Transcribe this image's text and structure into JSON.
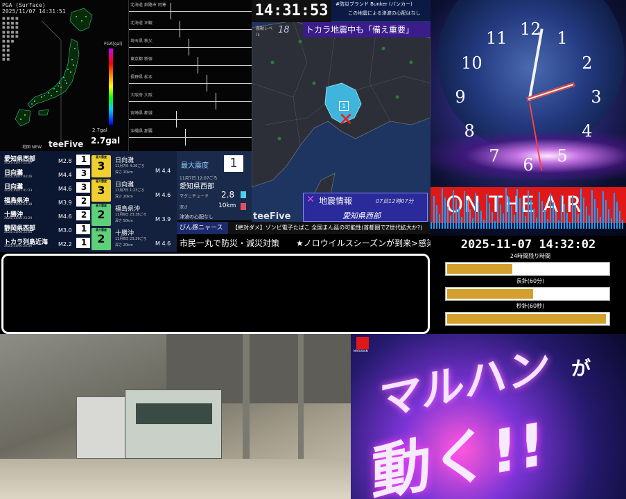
{
  "pga": {
    "title": "PGA (Surface)",
    "timestamp": "2025/11/07 14:31:51",
    "scale_label": "PGA[gal]",
    "gal_small": "2.7gal",
    "gal_big": "2.7gal",
    "logo": "teeFive",
    "new_label": "地図 NEW"
  },
  "waveforms": {
    "stations": [
      "北海道 釧路市 阿寒",
      "北海道 正観",
      "埼玉県 秩父",
      "東京都 新宿",
      "長野県 松本",
      "大阪府 大阪",
      "宮崎県 都城",
      "沖縄県 那覇"
    ]
  },
  "quake_list": [
    {
      "name": "愛知県西部",
      "date": "2025/11/07 12:07",
      "mag": "M2.8",
      "int": "1"
    },
    {
      "name": "日向灘",
      "date": "2025/11/07 04:26",
      "mag": "M4.4",
      "int": "3"
    },
    {
      "name": "日向灘",
      "date": "2025/11/07 01:23",
      "mag": "M4.6",
      "int": "3"
    },
    {
      "name": "福島県沖",
      "date": "2025/11/06 23:38",
      "mag": "M3.9",
      "int": "2"
    },
    {
      "name": "十勝沖",
      "date": "2025/11/06 23:29",
      "mag": "M4.6",
      "int": "2"
    },
    {
      "name": "静岡県西部",
      "date": "2025/11/06 22:05",
      "mag": "M3.0",
      "int": "1"
    },
    {
      "name": "トカラ列島近海",
      "date": "2025/11/06 20:16",
      "mag": "M2.2",
      "int": "1"
    }
  ],
  "detail_list": [
    {
      "label": "最大震度",
      "int": "3",
      "name": "日向灘",
      "sub": "11月7日 4:26ごろ",
      "depth": "深さ 20km",
      "mag": "M 4.4",
      "color": "#f0d030"
    },
    {
      "label": "最大震度",
      "int": "3",
      "name": "日向灘",
      "sub": "11月7日 1:23ごろ",
      "depth": "深さ 20km",
      "mag": "M 4.6",
      "color": "#f0d030"
    },
    {
      "label": "最大震度",
      "int": "2",
      "name": "福島県沖",
      "sub": "11月6日 23:38ごろ",
      "depth": "深さ 50km",
      "mag": "M 3.9",
      "color": "#5fd07a"
    },
    {
      "label": "最大震度",
      "int": "2",
      "name": "十勝沖",
      "sub": "11月6日 23:29ごろ",
      "depth": "深さ 20km",
      "mag": "M 4.6",
      "color": "#5fd07a"
    }
  ],
  "max_intensity": {
    "label": "最大震度",
    "value": "1",
    "time": "11月7日 12:07ごろ",
    "area": "愛知県西部",
    "mag_label": "マグニチュード",
    "mag": "2.8",
    "depth_label": "深さ",
    "depth": "10km",
    "tsunami": "津波の心配なし"
  },
  "map_panel": {
    "time": "14:31:53",
    "bunker_title": "#防災ブランド Bunker (バンカー)",
    "bunker_sub": "この地震による津波の心配はなし",
    "level_label": "震動レベル",
    "level": "18",
    "banner": "トカラ地震中も「備え重要」",
    "pin_label": "1",
    "info_title": "地震情報",
    "info_time": "07日12時07分",
    "info_area": "愛知県西部",
    "logo": "teeFive"
  },
  "ticker": {
    "tag": "びん感ニャース",
    "line1": "【絶対ダメ】ゾンビ電子たばこ 全国まん延の可能性(首都圏でZ世代拡大か?)",
    "line2": "市民一丸で防災・減災対策　　★ノロウイルスシーズンが到来>感染"
  },
  "analog_clock": {
    "numerals": [
      "12",
      "1",
      "2",
      "3",
      "4",
      "5",
      "6",
      "7",
      "8",
      "9",
      "10",
      "11"
    ],
    "on_air": "ON THE AIR"
  },
  "right_panel": {
    "timestamp": "2025-11-07 14:32:02",
    "bars": [
      {
        "label": "24時間残り時間",
        "fill": 0.4
      },
      {
        "label": "長針(60分)",
        "fill": 0.53
      },
      {
        "label": "秒針(60秒)",
        "fill": 0.98
      }
    ]
  },
  "promo": {
    "text1": "マルハン",
    "text2": "が",
    "text3": "動く!!",
    "brand": "MARUHAN"
  }
}
